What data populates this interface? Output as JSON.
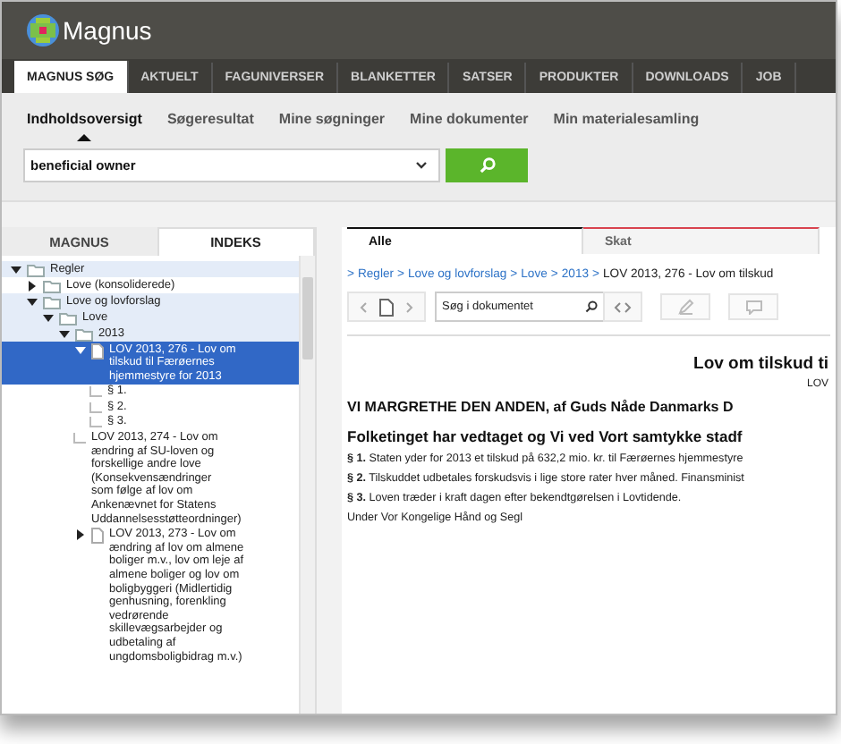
{
  "logo": {
    "text": "Magnus"
  },
  "nav": [
    {
      "label": "MAGNUS SØG",
      "selected": true
    },
    {
      "label": "AKTUELT",
      "selected": false
    },
    {
      "label": "FAGUNIVERSER",
      "selected": false
    },
    {
      "label": "BLANKETTER",
      "selected": false
    },
    {
      "label": "SATSER",
      "selected": false
    },
    {
      "label": "PRODUKTER",
      "selected": false
    },
    {
      "label": "DOWNLOADS",
      "selected": false
    },
    {
      "label": "JOB",
      "selected": false
    }
  ],
  "subnav": [
    {
      "label": "Indholdsoversigt",
      "selected": true
    },
    {
      "label": "Søgeresultat",
      "selected": false
    },
    {
      "label": "Mine søgninger",
      "selected": false
    },
    {
      "label": "Mine dokumenter",
      "selected": false
    },
    {
      "label": "Min materialesamling",
      "selected": false
    }
  ],
  "search": {
    "value": "beneficial owner"
  },
  "left_tabs": [
    {
      "label": "MAGNUS",
      "selected": false
    },
    {
      "label": "INDEKS",
      "selected": true
    }
  ],
  "tree": [
    {
      "kind": "folder",
      "label": "Regler",
      "expanded": true,
      "highlighted": true,
      "selected": false,
      "children": [
        {
          "kind": "folder",
          "label": "Love (konsoliderede)",
          "expanded": false,
          "highlighted": false,
          "selected": false
        },
        {
          "kind": "folder",
          "label": "Love og lovforslag",
          "expanded": true,
          "highlighted": true,
          "selected": false,
          "children": [
            {
              "kind": "folder",
              "label": "Love",
              "expanded": true,
              "highlighted": true,
              "selected": false,
              "children": [
                {
                  "kind": "folder",
                  "label": "2013",
                  "expanded": true,
                  "highlighted": true,
                  "selected": false,
                  "children": [
                    {
                      "kind": "document",
                      "label": "LOV 2013, 276 - Lov om tilskud til Færøernes hjemmestyre for 2013",
                      "expanded": true,
                      "selected": true,
                      "children": [
                        {
                          "kind": "leaf",
                          "label": "§ 1.",
                          "highlighted": false,
                          "selected": false
                        },
                        {
                          "kind": "leaf",
                          "label": "§ 2.",
                          "highlighted": false,
                          "selected": false
                        },
                        {
                          "kind": "leaf",
                          "label": "§ 3.",
                          "highlighted": false,
                          "selected": false
                        }
                      ]
                    },
                    {
                      "kind": "leaf",
                      "label": "LOV 2013, 274 - Lov om ændring af SU-loven og forskellige andre love (Konsekvensændringer som følge af lov om Ankenævnet for Statens Uddannelsesstøtteordninger)",
                      "highlighted": false,
                      "selected": false
                    },
                    {
                      "kind": "document",
                      "label": "LOV 2013, 273 - Lov om ændring af lov om almene boliger m.v., lov om leje af almene boliger og lov om boligbyggeri (Midlertidig genhusning, forenkling vedrørende skillevægsarbejder og udbetaling af ungdomsboligbidrag m.v.)",
                      "expanded": false,
                      "highlighted": false,
                      "selected": false
                    }
                  ]
                }
              ]
            }
          ]
        }
      ]
    }
  ],
  "right_tabs": [
    {
      "label": "Alle",
      "selected": true,
      "color": "#111111"
    },
    {
      "label": "Skat",
      "selected": false,
      "color": "#d9434f"
    }
  ],
  "breadcrumb": {
    "separator": ">",
    "links": [
      "Regler",
      "Love og lovforslag",
      "Love",
      "2013"
    ],
    "current": "LOV 2013, 276 - Lov om tilskud"
  },
  "doc_search": {
    "placeholder": "Søg i dokumentet"
  },
  "document": {
    "title": "Lov om tilskud ti",
    "subtitle": "LOV",
    "preamble": "VI MARGRETHE DEN ANDEN, af Guds Nåde Danmarks D",
    "heading": "Folketinget har vedtaget og Vi ved Vort samtykke stadf",
    "paragraphs": [
      "**§ 1.** Staten yder for 2013 et tilskud på 632,2 mio. kr. til Færøernes hjemmestyre",
      "**§ 2.** Tilskuddet udbetales forskudsvis i lige store rater hver måned. Finansminist",
      "**§ 3.** Loven træder i kraft dagen efter bekendtgørelsen i Lovtidende.",
      "Under Vor Kongelige Hånd og Segl"
    ]
  }
}
